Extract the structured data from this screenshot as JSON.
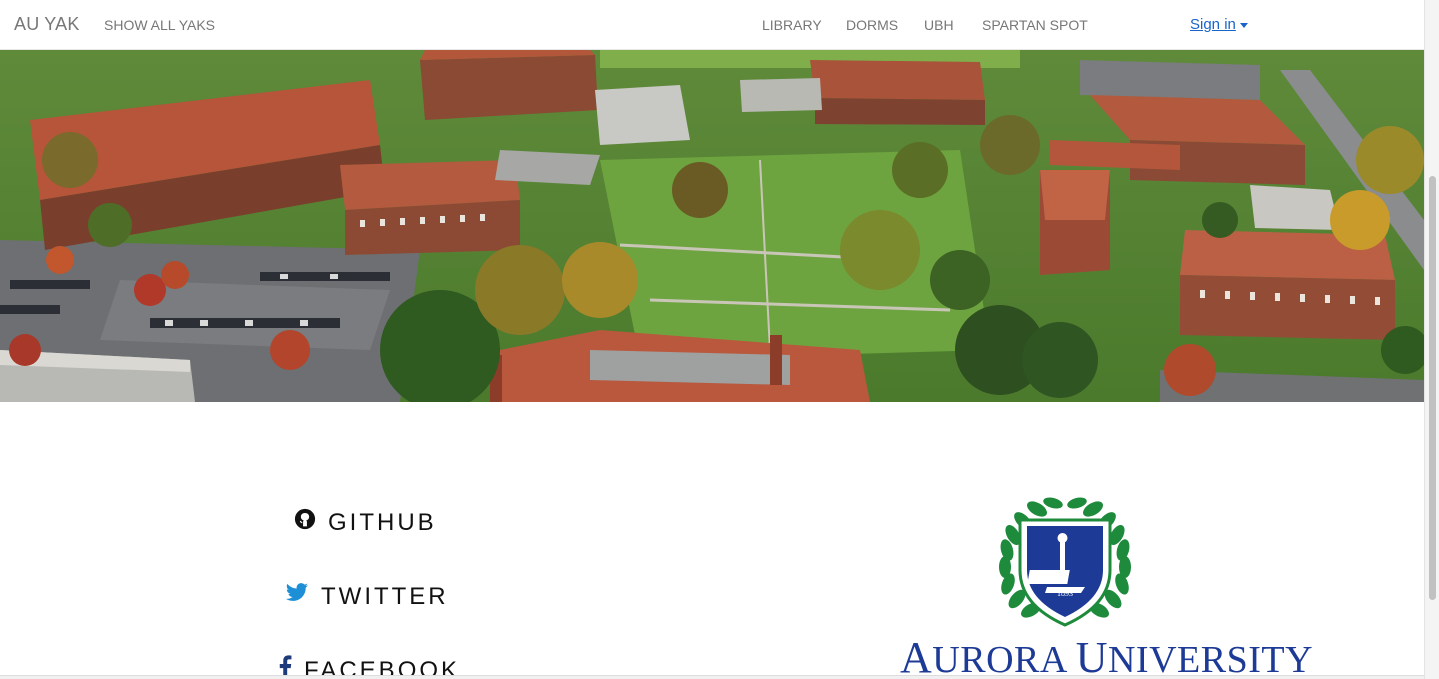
{
  "navbar": {
    "brand": "AU YAK",
    "show_all": "SHOW ALL YAKS",
    "links": [
      "LIBRARY",
      "DORMS",
      "UBH",
      "SPARTAN SPOT"
    ],
    "signin": "Sign in"
  },
  "hero": {
    "alt": "Aerial view of campus"
  },
  "social": {
    "github": "GITHUB",
    "twitter": "TWITTER",
    "facebook": "FACEBOOK"
  },
  "logo": {
    "year": "1893",
    "name_first_cap": "A",
    "name_first_rest": "URORA ",
    "name_second_cap": "U",
    "name_second_rest": "NIVERSITY"
  },
  "colors": {
    "link_blue": "#1a64c8",
    "logo_blue": "#1d3b96",
    "laurel_green": "#1e8a3c"
  }
}
